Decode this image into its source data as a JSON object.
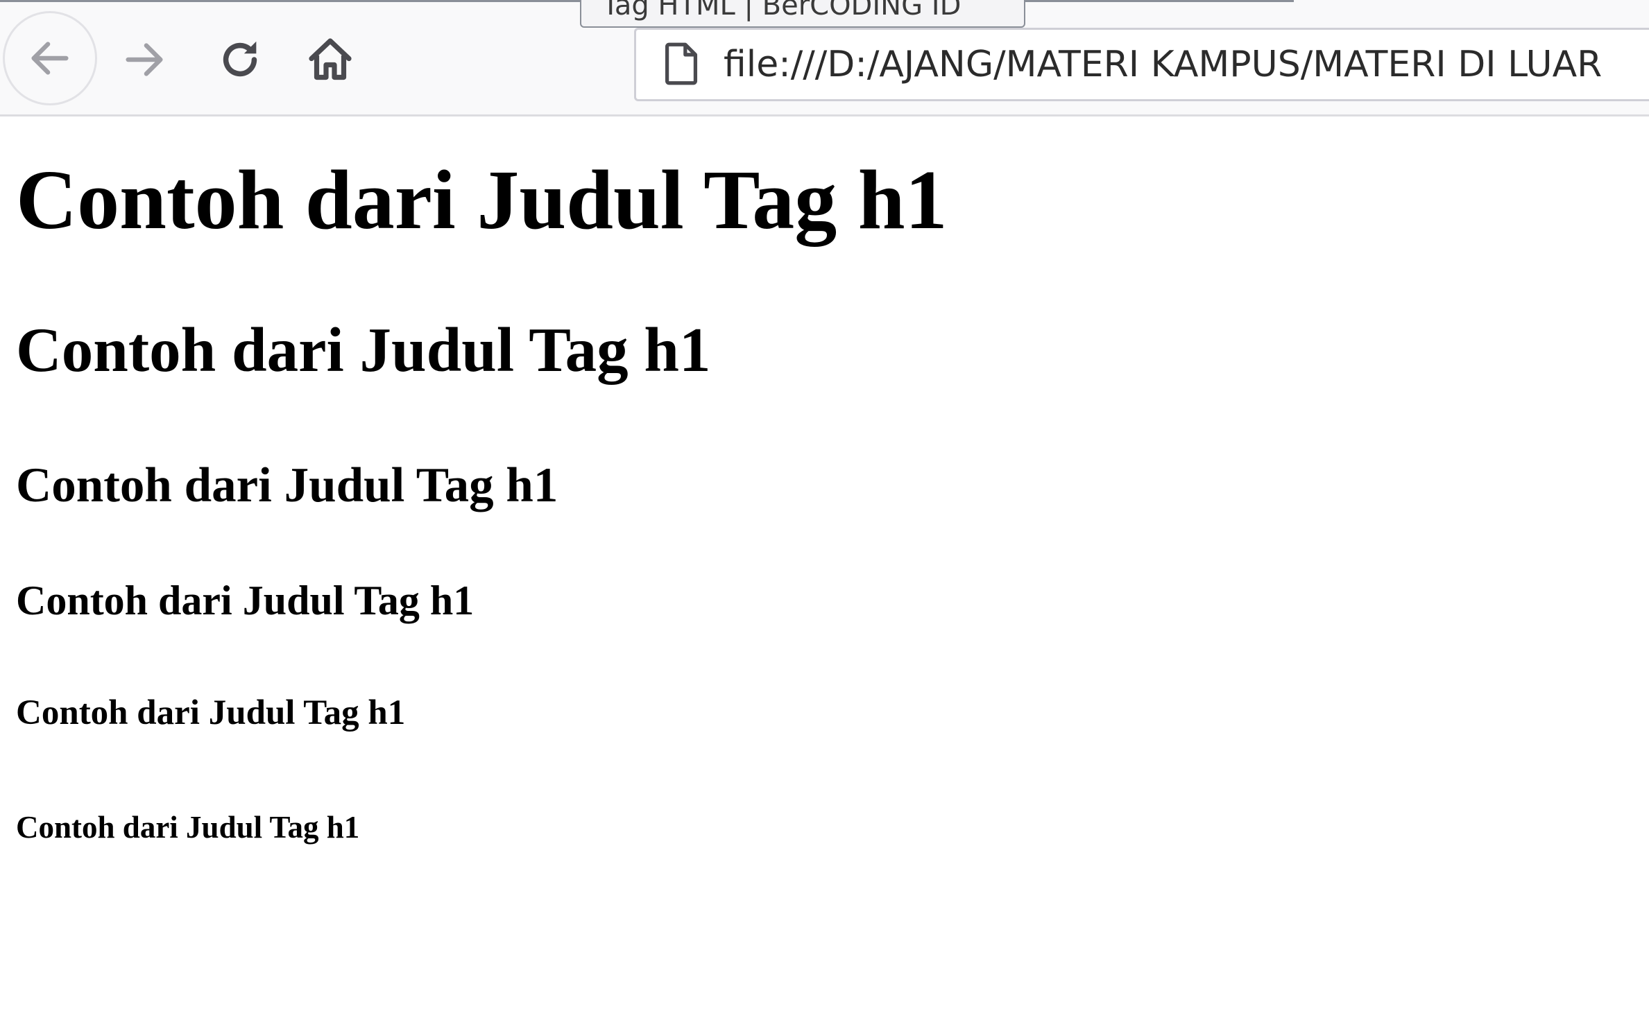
{
  "browser": {
    "tab_tooltip": "Tag HTML | BerCODING ID",
    "address_bar": {
      "url": "file:///D:/AJANG/MATERI KAMPUS/MATERI DI LUAR"
    },
    "icons": {
      "back": "back-arrow-icon",
      "forward": "forward-arrow-icon",
      "reload": "reload-icon",
      "home": "home-icon",
      "page": "page-icon"
    }
  },
  "document": {
    "headings": [
      {
        "level": 1,
        "text": "Contoh dari Judul Tag h1"
      },
      {
        "level": 2,
        "text": "Contoh dari Judul Tag h1"
      },
      {
        "level": 3,
        "text": "Contoh dari Judul Tag h1"
      },
      {
        "level": 4,
        "text": "Contoh dari Judul Tag h1"
      },
      {
        "level": 5,
        "text": "Contoh dari Judul Tag h1"
      },
      {
        "level": 6,
        "text": "Contoh dari Judul Tag h1"
      }
    ]
  },
  "colors": {
    "chrome_background": "#f9f9fa",
    "icon": "#4a4a4f",
    "disabled_icon": "#a0a0a6",
    "text": "#000000"
  }
}
